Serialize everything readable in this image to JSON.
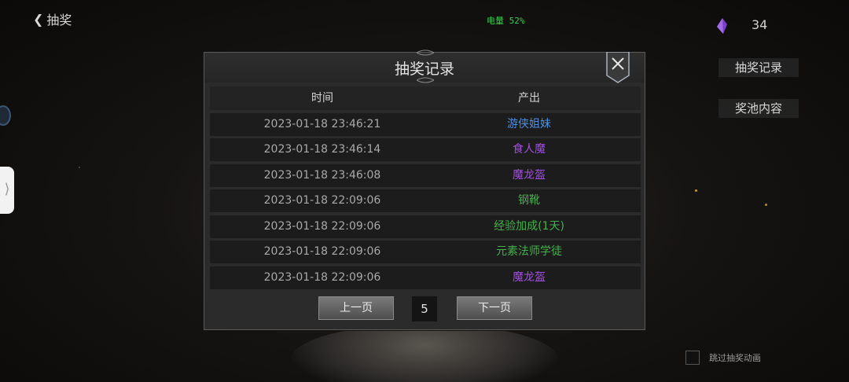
{
  "header": {
    "back_label": "抽奖",
    "battery": "电量 52%",
    "gem_count": "34"
  },
  "sidebar": {
    "record_btn": "抽奖记录",
    "pool_btn": "奖池内容"
  },
  "skip": {
    "label": "跳过抽奖动画"
  },
  "dialog": {
    "title": "抽奖记录",
    "col_time": "时间",
    "col_item": "产出",
    "rows": [
      {
        "time": "2023-01-18 23:46:21",
        "item": "游侠姐妹",
        "color": "#4d8fe0"
      },
      {
        "time": "2023-01-18 23:46:14",
        "item": "食人魔",
        "color": "#a24fe0"
      },
      {
        "time": "2023-01-18 23:46:08",
        "item": "魔龙盔",
        "color": "#a24fe0"
      },
      {
        "time": "2023-01-18 22:09:06",
        "item": "钢靴",
        "color": "#43b04a"
      },
      {
        "time": "2023-01-18 22:09:06",
        "item": "经验加成(1天)",
        "color": "#43b04a"
      },
      {
        "time": "2023-01-18 22:09:06",
        "item": "元素法师学徒",
        "color": "#43b04a"
      },
      {
        "time": "2023-01-18 22:09:06",
        "item": "魔龙盔",
        "color": "#a24fe0"
      }
    ],
    "prev_label": "上一页",
    "page": "5",
    "next_label": "下一页"
  }
}
